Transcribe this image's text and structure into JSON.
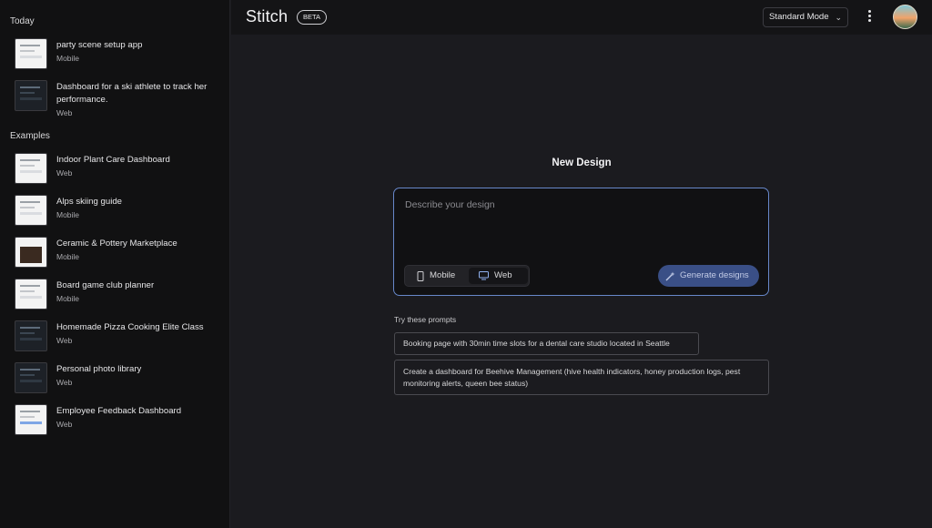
{
  "sidebar": {
    "today_label": "Today",
    "examples_label": "Examples",
    "today_items": [
      {
        "title": "party scene setup app",
        "platform": "Mobile"
      },
      {
        "title": "Dashboard for a ski athlete to track her performance.",
        "platform": "Web"
      }
    ],
    "example_items": [
      {
        "title": "Indoor Plant Care Dashboard",
        "platform": "Web"
      },
      {
        "title": "Alps skiing guide",
        "platform": "Mobile"
      },
      {
        "title": "Ceramic & Pottery Marketplace",
        "platform": "Mobile"
      },
      {
        "title": "Board game club planner",
        "platform": "Mobile"
      },
      {
        "title": "Homemade Pizza Cooking Elite Class",
        "platform": "Web"
      },
      {
        "title": "Personal photo library",
        "platform": "Web"
      },
      {
        "title": "Employee Feedback Dashboard",
        "platform": "Web"
      }
    ]
  },
  "header": {
    "app_name": "Stitch",
    "badge": "BETA",
    "mode_selected": "Standard Mode"
  },
  "main": {
    "title": "New Design",
    "placeholder": "Describe your design",
    "platform_options": [
      "Mobile",
      "Web"
    ],
    "selected_platform": "Web",
    "generate_label": "Generate designs",
    "try_label": "Try these prompts",
    "prompts": [
      "Booking page with 30min time slots for a dental care studio located in Seattle",
      "Create a dashboard for Beehive Management (hive health indicators, honey production logs, pest monitoring alerts, queen bee status)"
    ]
  },
  "colors": {
    "background": "#1b1b1f",
    "sidebar": "#111112",
    "accent_border": "#6787c9",
    "generate_button": "#3a4f86"
  }
}
